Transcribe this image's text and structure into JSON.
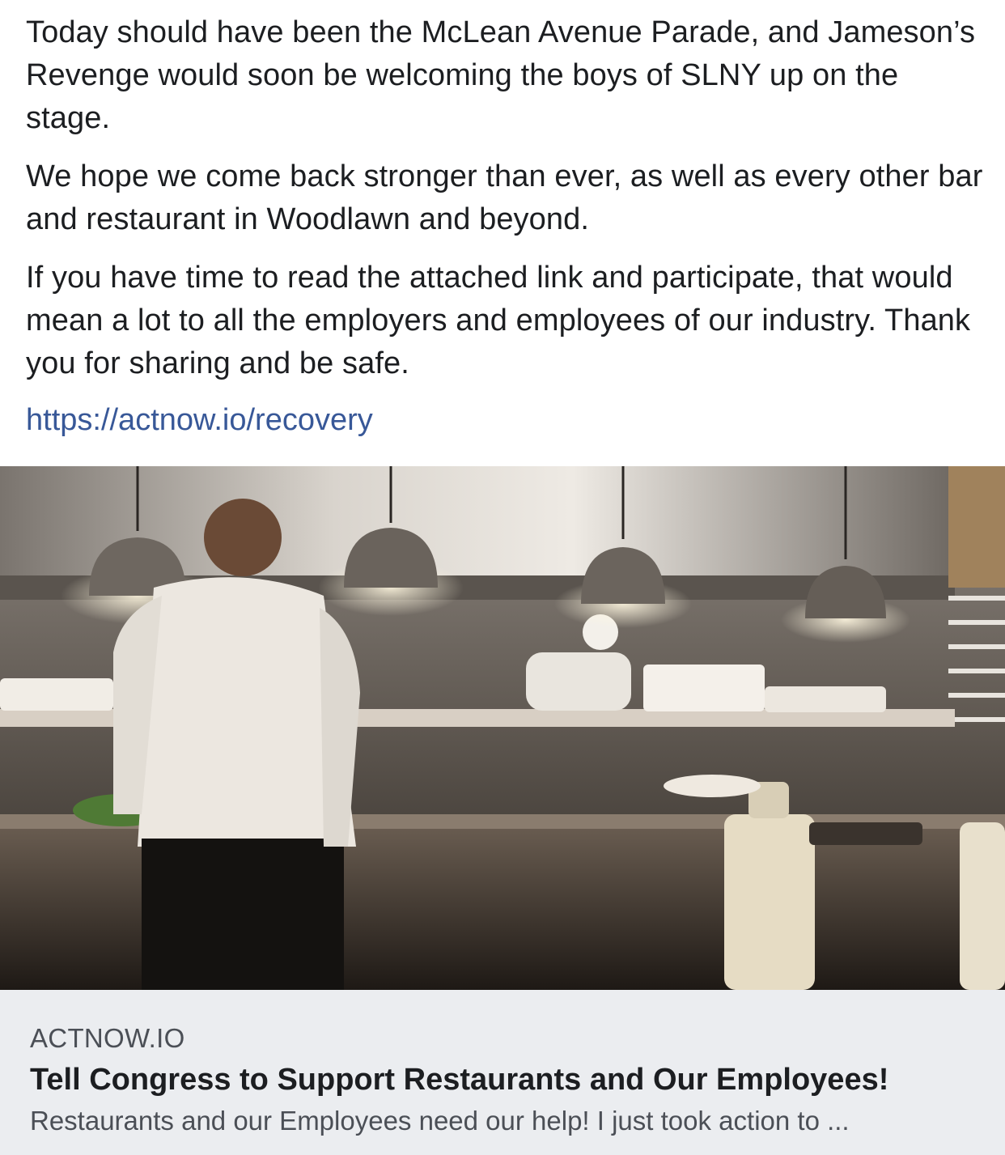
{
  "post": {
    "paragraphs": [
      "Today should have been the McLean Avenue Parade, and Jameson’s Revenge would soon be welcoming the boys of SLNY up on the stage.",
      "We hope we come back stronger than ever, as well as every other bar and restaurant in Woodlawn and beyond.",
      "If you have time to read the attached link and participate, that would mean a lot to all the employers and employees of our industry. Thank you for sharing and be safe."
    ],
    "link_text": "https://actnow.io/recovery"
  },
  "link_card": {
    "image_icon": "restaurant-kitchen-photo",
    "domain": "ACTNOW.IO",
    "title": "Tell Congress to Support Restaurants and Our Employees!",
    "description": "Restaurants and our Employees need our help! I just took action to ..."
  },
  "colors": {
    "text": "#1c1e21",
    "link": "#385898",
    "card_background": "#ebedf0",
    "card_secondary_text": "#4b4f56"
  }
}
